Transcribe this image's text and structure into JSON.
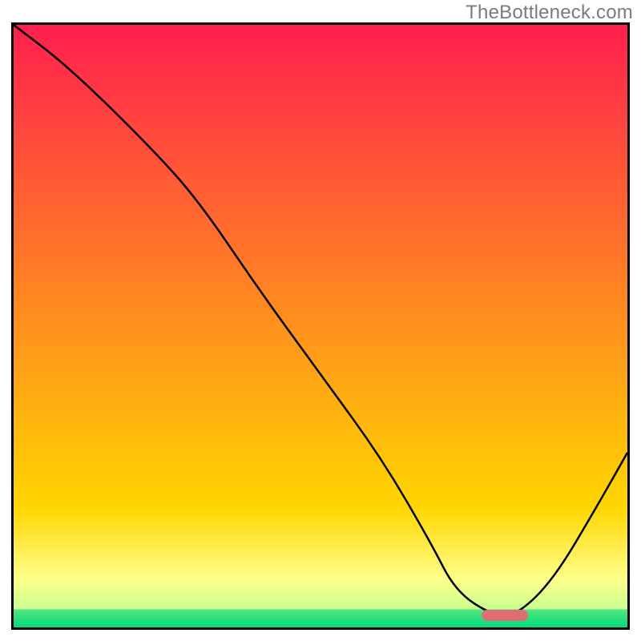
{
  "watermark": "TheBottleneck.com",
  "chart_data": {
    "type": "line",
    "title": "",
    "xlabel": "",
    "ylabel": "",
    "xlim": [
      0,
      100
    ],
    "ylim": [
      0,
      100
    ],
    "grid": false,
    "legend": false,
    "gradient_bands": [
      {
        "y_from": 100,
        "y_to": 20,
        "color_from": "#ff1f4e",
        "color_to": "#ffd600"
      },
      {
        "y_from": 20,
        "y_to": 8,
        "color_from": "#ffd600",
        "color_to": "#ffff8a"
      },
      {
        "y_from": 8,
        "y_to": 3,
        "color_from": "#ffff8a",
        "color_to": "#c8ff90"
      },
      {
        "y_from": 3,
        "y_to": 0,
        "color_from": "#55e57f",
        "color_to": "#00dd7d"
      }
    ],
    "series": [
      {
        "name": "bottleneck-curve",
        "x": [
          0,
          9,
          22,
          30,
          40,
          50,
          60,
          68,
          72,
          78,
          82,
          88,
          95,
          100
        ],
        "y": [
          100,
          93,
          80,
          71,
          56,
          42,
          28,
          14,
          6,
          2,
          2,
          8,
          20,
          29
        ]
      }
    ],
    "marker": {
      "x_center": 80,
      "x_width": 7.5,
      "y": 2,
      "color": "#de6e74"
    }
  }
}
